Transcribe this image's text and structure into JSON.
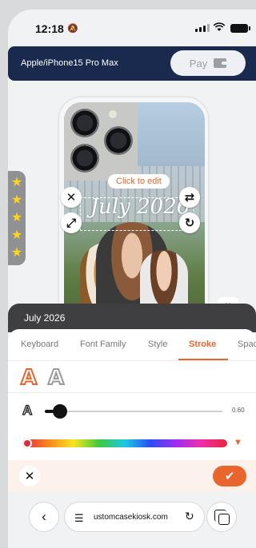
{
  "status_bar": {
    "time": "12:18"
  },
  "header": {
    "model": "Apple/iPhone15 Pro Max",
    "pay_label": "Pay"
  },
  "canvas": {
    "click_to_edit": "Click to edit",
    "text_preview": "July 2026"
  },
  "rating": {
    "stars": 5
  },
  "editor": {
    "text_value": "July 2026",
    "tabs": [
      {
        "label": "Keyboard"
      },
      {
        "label": "Font Family"
      },
      {
        "label": "Style"
      },
      {
        "label": "Stroke",
        "active": true
      },
      {
        "label": "Spac"
      }
    ],
    "stroke_width": "0.60",
    "accent_color": "#e8652d"
  },
  "browser": {
    "url": "ustomcasekiosk.com"
  }
}
